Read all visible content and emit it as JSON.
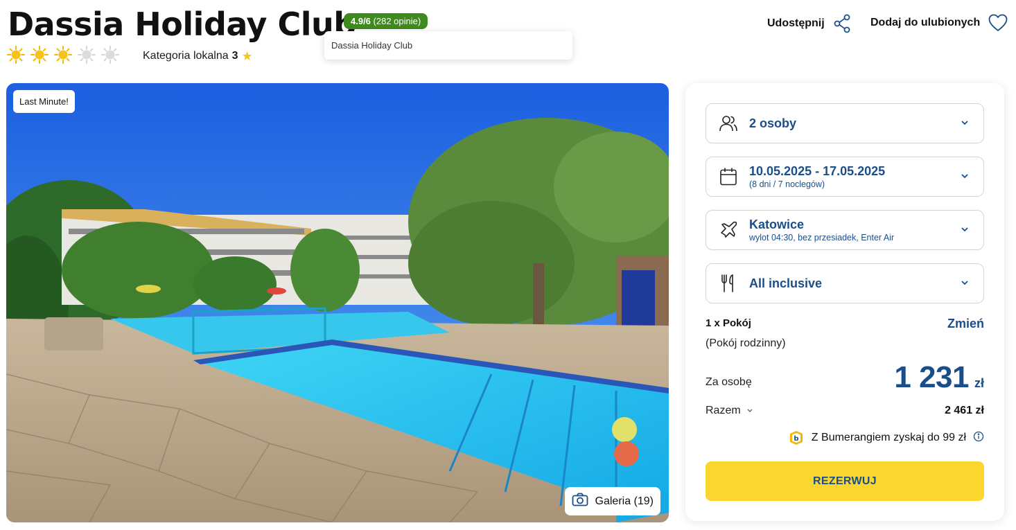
{
  "hotel": {
    "name": "Dassia Holiday Club",
    "stars_filled": 3,
    "stars_total": 5,
    "category_label": "Kategoria lokalna",
    "category_value": "3"
  },
  "rating": {
    "score": "4.9/6",
    "reviews": "(282 opinie)",
    "tooltip": "Dassia Holiday Club"
  },
  "actions": {
    "share_label": "Udostępnij",
    "favorite_label": "Dodaj do ulubionych"
  },
  "photo": {
    "badge": "Last Minute!",
    "gallery_label": "Galeria (19)"
  },
  "booking": {
    "persons": "2 osoby",
    "dates": "10.05.2025 - 17.05.2025",
    "dates_sub": "(8 dni / 7 noclegów)",
    "departure": "Katowice",
    "departure_sub": "wylot 04:30, bez przesiadek, Enter Air",
    "board": "All inclusive",
    "room_title": "1 x Pokój",
    "room_type": "(Pokój rodzinny)",
    "change_label": "Zmień",
    "per_person_label": "Za osobę",
    "price": "1 231",
    "currency": "zł",
    "total_label": "Razem",
    "total_value": "2 461 zł",
    "bumerang_text": "Z Bumerangiem zyskaj do 99 zł",
    "book_label": "REZERWUJ"
  },
  "colors": {
    "accent_blue": "#1a4e8a",
    "rating_green": "#3f8a1c",
    "book_yellow": "#fbd62f",
    "star_yellow": "#f5c518"
  }
}
